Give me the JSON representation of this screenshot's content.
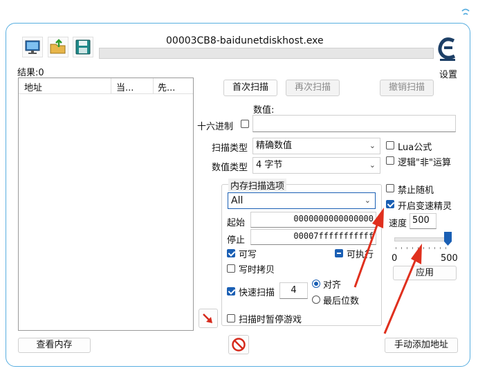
{
  "window": {
    "title": "00003CB8-baidunetdiskhost.exe"
  },
  "toolbar": {
    "settings_label": "设置",
    "icons": [
      "computer-icon",
      "open-folder-icon",
      "save-disk-icon",
      "cheat-engine-logo-icon"
    ]
  },
  "results": {
    "label": "结果:0"
  },
  "list": {
    "columns": [
      "地址",
      "当...",
      "先..."
    ]
  },
  "scan_buttons": {
    "first": "首次扫描",
    "next": "再次扫描",
    "undo": "撤销扫描"
  },
  "value": {
    "label": "数值:",
    "hex_label": "十六进制",
    "value": ""
  },
  "scan_type": {
    "label": "扫描类型",
    "selected": "精确数值"
  },
  "value_type": {
    "label": "数值类型",
    "selected": "4 字节"
  },
  "options_right": {
    "lua": "Lua公式",
    "not_op": "逻辑\"非\"运算",
    "no_random": "禁止随机",
    "speedhack": "开启变速精灵",
    "speed_label": "速度",
    "speed_value": "500",
    "slider_min": "0",
    "slider_max": "500",
    "slider_fraction": 1.0,
    "apply": "应用"
  },
  "memory": {
    "group_label": "内存扫描选项",
    "region": "All",
    "start_label": "起始",
    "start_value": "0000000000000000",
    "stop_label": "停止",
    "stop_value": "00007fffffffffff",
    "writable": "可写",
    "executable": "可执行",
    "copy_on_write": "写时拷贝",
    "fast_scan": "快速扫描",
    "fast_scan_value": "4",
    "align": "对齐",
    "last_digits": "最后位数",
    "pause_game": "扫描时暂停游戏"
  },
  "bottom": {
    "view_memory": "查看内存",
    "add_address": "手动添加地址"
  },
  "colors": {
    "accent": "#1a5fb4",
    "arrow": "#e0301e",
    "frame": "#58aee0"
  }
}
